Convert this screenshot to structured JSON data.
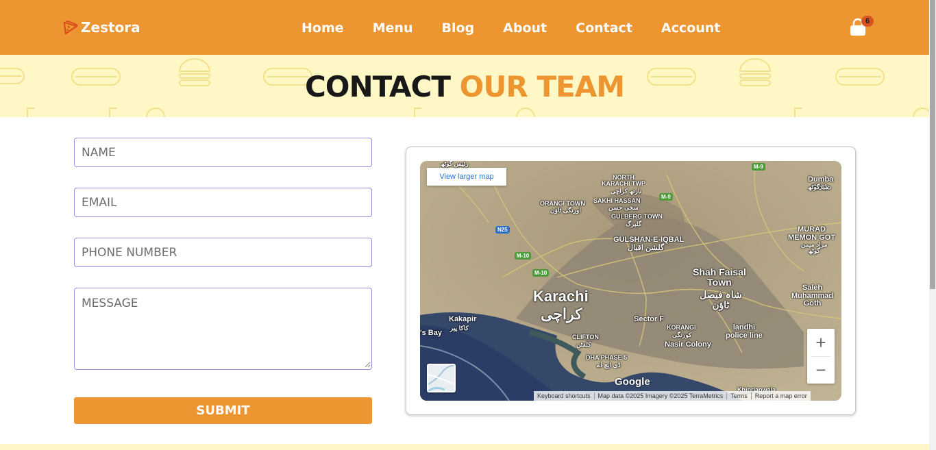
{
  "brand": {
    "name": "Zestora",
    "logo_icon": "pizza-slice-icon",
    "primary_color": "#ed9530",
    "banner_color": "#fff8c6"
  },
  "nav": {
    "items": [
      {
        "label": "Home"
      },
      {
        "label": "Menu"
      },
      {
        "label": "Blog"
      },
      {
        "label": "About"
      },
      {
        "label": "Contact"
      },
      {
        "label": "Account"
      }
    ]
  },
  "cart": {
    "icon": "shopping-bag-icon",
    "count": "6"
  },
  "banner": {
    "title_part1": "CONTACT",
    "title_part2": "OUR TEAM"
  },
  "form": {
    "name_placeholder": "NAME",
    "email_placeholder": "EMAIL",
    "phone_placeholder": "PHONE NUMBER",
    "message_placeholder": "MESSAGE",
    "submit_label": "SUBMIT"
  },
  "map": {
    "view_larger": "View larger map",
    "zoom_in": "+",
    "zoom_out": "−",
    "google": "Google",
    "attribution": {
      "shortcuts": "Keyboard shortcuts",
      "data": "Map data ©2025 Imagery ©2025 TerraMetrics",
      "terms": "Terms",
      "report": "Report a map error"
    },
    "labels": {
      "karachi": "Karachi",
      "karachi_ur": "کراچی",
      "north_karachi": "NORTH\nKARACHI TWP",
      "north_karachi_ur": "نارتھ کراچی",
      "orangi": "ORANGI TOWN",
      "orangi_ur": "اورنگی ٹاؤن",
      "sakhi": "SAKHI HASSAN",
      "sakhi_ur": "سخی حسن",
      "gulberg": "GULBERG TOWN",
      "gulberg_ur": "گلبرگ",
      "gulshan": "GULSHAN-E-IQBAL",
      "gulshan_ur": "گلشن اقبال",
      "shah_faisal": "Shah Faisal\nTown",
      "shah_faisal_ur": "شاہ فیصل\nٹاؤن",
      "dumba": "Dumba\nGoth",
      "dumba_ur": "دمبا گوٹھ",
      "murad": "MURAD\nMEMON GOT",
      "murad_ur": "مراد میمن\nگوٹھ",
      "saleh": "Saleh\nMuhammad\nGoth",
      "kakapir": "Kakapir",
      "kakapir_ur": "کاکا پیر",
      "bay": "'s Bay",
      "sector_f": "Sector F",
      "korangi": "KORANGI",
      "korangi_ur": "کورنگی",
      "landhi": "landhi\npolice line",
      "nasir": "Nasir Colony",
      "clifton": "CLIFTON",
      "clifton_ur": "کلفٹن",
      "dha": "DHA PHASE 5",
      "dha_ur": "ڈی ایچ اے",
      "khiprianwala": "Khiprianwala",
      "top_ur": "رئیس گوٹھ"
    },
    "shields": {
      "n25": "N25",
      "m10a": "M-10",
      "m10b": "M-10",
      "m9a": "M-9",
      "m9b": "M-9"
    }
  }
}
